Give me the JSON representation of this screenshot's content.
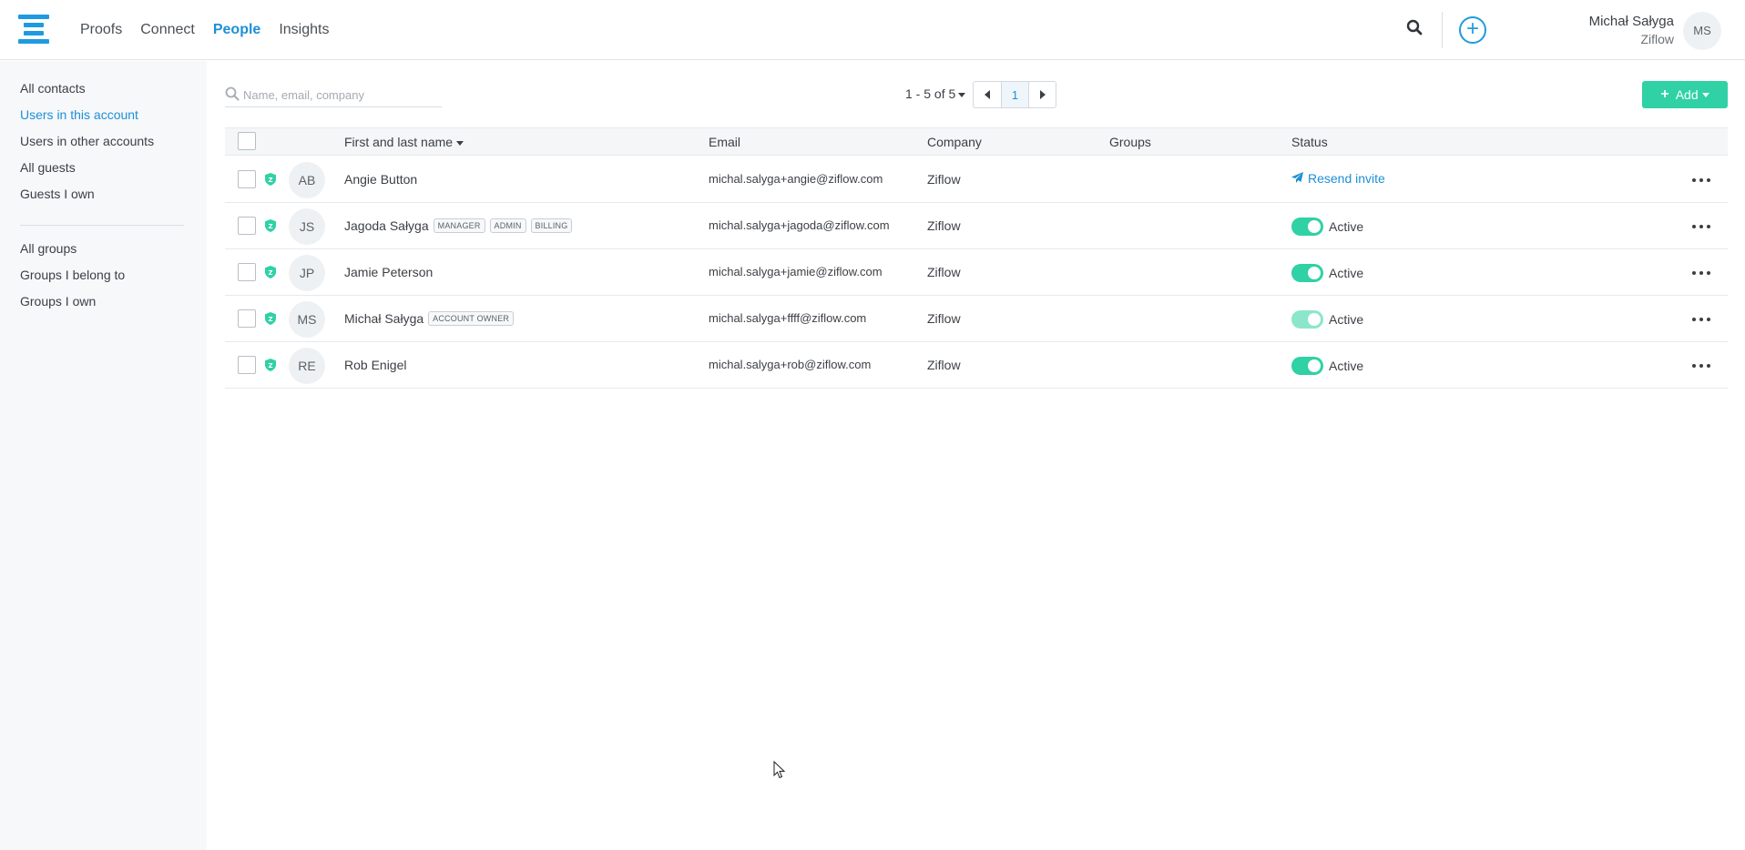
{
  "nav": {
    "items": [
      {
        "label": "Proofs",
        "active": false
      },
      {
        "label": "Connect",
        "active": false
      },
      {
        "label": "People",
        "active": true
      },
      {
        "label": "Insights",
        "active": false
      }
    ]
  },
  "user": {
    "name": "Michał Sałyga",
    "org": "Ziflow",
    "initials": "MS"
  },
  "sidebar": {
    "contacts": [
      "All contacts",
      "Users in this account",
      "Users in other accounts",
      "All guests",
      "Guests I own"
    ],
    "groups": [
      "All groups",
      "Groups I belong to",
      "Groups I own"
    ],
    "active": "Users in this account"
  },
  "search": {
    "placeholder": "Name, email, company",
    "value": ""
  },
  "pagination": {
    "range": "1 - 5 of 5",
    "page": "1"
  },
  "add_button": {
    "label": "Add"
  },
  "table": {
    "columns": {
      "name": "First and last name",
      "email": "Email",
      "company": "Company",
      "groups": "Groups",
      "status": "Status"
    },
    "rows": [
      {
        "initials": "AB",
        "name": "Angie Button",
        "badges": [],
        "email": "michal.salyga+angie@ziflow.com",
        "company": "Ziflow",
        "status": "Resend invite",
        "status_type": "invite"
      },
      {
        "initials": "JS",
        "name": "Jagoda Sałyga",
        "badges": [
          "MANAGER",
          "ADMIN",
          "BILLING"
        ],
        "email": "michal.salyga+jagoda@ziflow.com",
        "company": "Ziflow",
        "status": "Active",
        "status_type": "active"
      },
      {
        "initials": "JP",
        "name": "Jamie Peterson",
        "badges": [],
        "email": "michal.salyga+jamie@ziflow.com",
        "company": "Ziflow",
        "status": "Active",
        "status_type": "active"
      },
      {
        "initials": "MS",
        "name": "Michał Sałyga",
        "badges": [
          "ACCOUNT OWNER"
        ],
        "email": "michal.salyga+ffff@ziflow.com",
        "company": "Ziflow",
        "status": "Active",
        "status_type": "active-disabled"
      },
      {
        "initials": "RE",
        "name": "Rob Enigel",
        "badges": [],
        "email": "michal.salyga+rob@ziflow.com",
        "company": "Ziflow",
        "status": "Active",
        "status_type": "active"
      }
    ]
  },
  "colors": {
    "accent": "#1e8fd6",
    "logo": "#1e9be0",
    "success": "#2fd1a5"
  }
}
